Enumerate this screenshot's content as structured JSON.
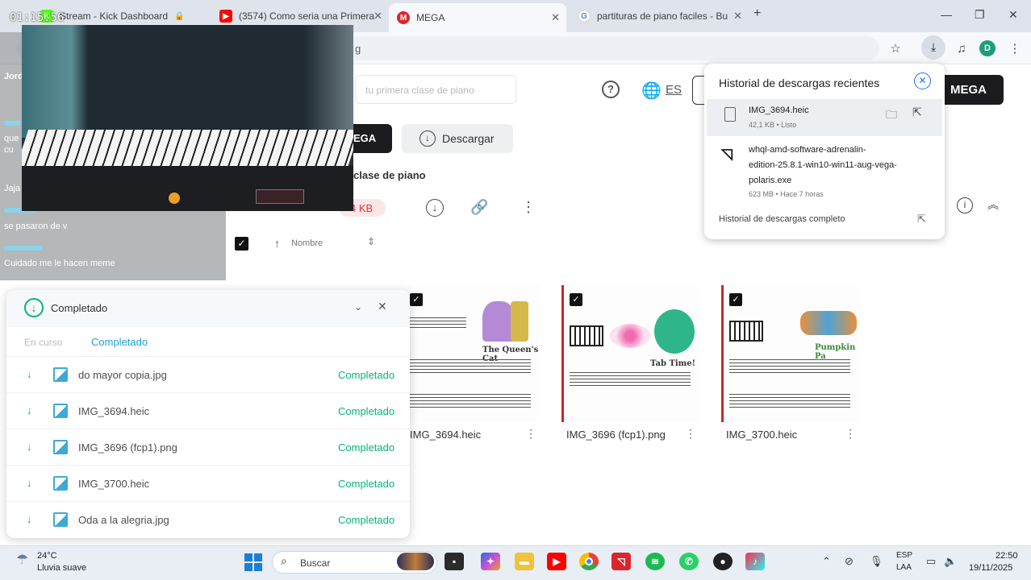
{
  "browser": {
    "tabs": [
      {
        "label": "Stream - Kick Dashboard",
        "favicon": "kick-icon",
        "color": "#53fc18"
      },
      {
        "label": "(3574) Como seria una Primera",
        "favicon": "youtube-icon",
        "color": "#ff0000"
      },
      {
        "label": "MEGA",
        "favicon": "mega-icon",
        "color": "#d9272e"
      },
      {
        "label": "partituras de piano faciles - Bu",
        "favicon": "google-icon",
        "color": "#4285f4"
      }
    ],
    "new_tab": "+",
    "omnibox_text": "g",
    "profile_initial": "D"
  },
  "downloads_popup": {
    "title": "Historial de descargas recientes",
    "items": [
      {
        "name": "IMG_3694.heic",
        "meta": "42,1 KB • Listo"
      },
      {
        "name_lines": [
          "whql-amd-software-adrenalin-",
          "edition-25.8.1-win10-win11-aug-vega-",
          "polaris.exe"
        ],
        "meta": "623 MB • Hace 7 horas"
      }
    ],
    "full_history": "Historial de descargas completo"
  },
  "mega": {
    "search_placeholder": "tu primera clase de piano",
    "lang": "ES",
    "top_button": "MEGA",
    "import_button": "EGA",
    "download_button": "Descargar",
    "folder_title": "clase de piano",
    "size": "4 KB",
    "sort_label": "Nombre",
    "files": [
      {
        "name": "IMG_3694.heic",
        "caption": "The Queen's Cat"
      },
      {
        "name": "IMG_3696 (fcp1).png",
        "caption": "Tab Time!"
      },
      {
        "name": "IMG_3700.heic",
        "caption": "Pumpkin Pa"
      }
    ]
  },
  "stream": {
    "timer": "01:15:56",
    "chat": [
      "Jord",
      "que",
      "cu",
      "Jaja",
      "se pasaron de v",
      "Cuidado me le hacen meme"
    ]
  },
  "transfers": {
    "title": "Completado",
    "tab_in_progress": "En curso",
    "tab_completed": "Completado",
    "rows": [
      {
        "name": "do mayor copia.jpg",
        "status": "Completado"
      },
      {
        "name": "IMG_3694.heic",
        "status": "Completado"
      },
      {
        "name": "IMG_3696 (fcp1).png",
        "status": "Completado"
      },
      {
        "name": "IMG_3700.heic",
        "status": "Completado"
      },
      {
        "name": "Oda a la alegria.jpg",
        "status": "Completado"
      }
    ]
  },
  "taskbar": {
    "temperature": "24°C",
    "weather": "Lluvia suave",
    "search_placeholder": "Buscar",
    "lang_line1": "ESP",
    "lang_line2": "LAA",
    "time": "22:50",
    "date": "19/11/2025"
  }
}
